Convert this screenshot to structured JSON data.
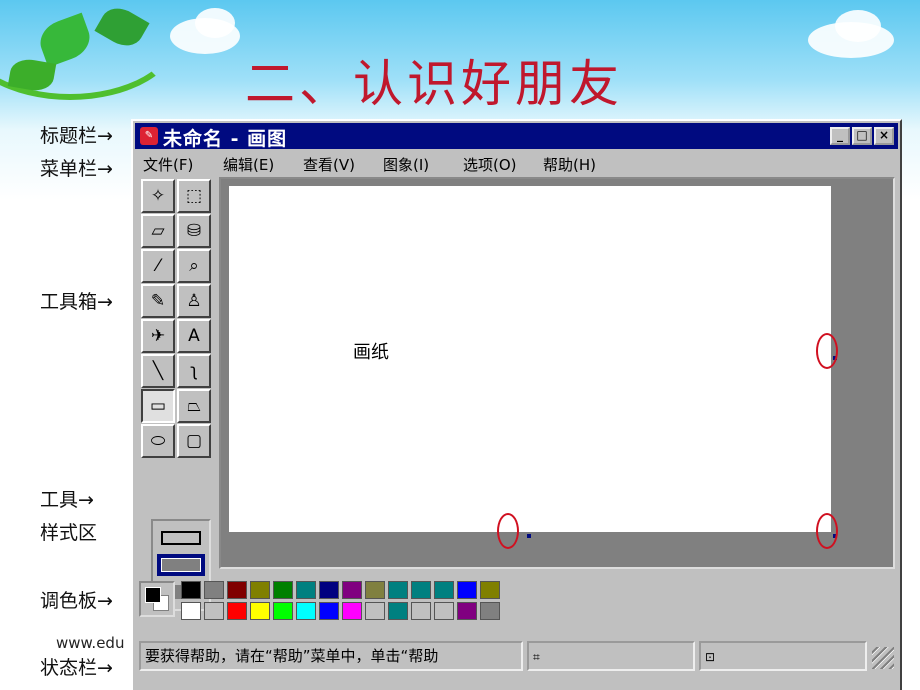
{
  "slide": {
    "title": "二、认识好朋友",
    "url_text": "www.edu"
  },
  "callouts": {
    "titlebar": "标题栏→",
    "menubar": "菜单栏→",
    "toolbox": "工具箱→",
    "tool_style_line1": "工具→",
    "tool_style_line2": "样式区",
    "palette": "调色板→",
    "statusbar": "状态栏→"
  },
  "window": {
    "title": "未命名 - 画图",
    "minimize": "_",
    "maximize": "□",
    "close": "×"
  },
  "menu": [
    "文件(F)",
    "编辑(E)",
    "查看(V)",
    "图象(I)",
    "选项(O)",
    "帮助(H)"
  ],
  "tools": [
    {
      "icon": "free-select-icon",
      "glyph": "✧"
    },
    {
      "icon": "rect-select-icon",
      "glyph": "⬚"
    },
    {
      "icon": "eraser-icon",
      "glyph": "▱"
    },
    {
      "icon": "fill-bucket-icon",
      "glyph": "⛁"
    },
    {
      "icon": "color-picker-icon",
      "glyph": "⁄"
    },
    {
      "icon": "magnifier-icon",
      "glyph": "⌕"
    },
    {
      "icon": "pencil-icon",
      "glyph": "✎"
    },
    {
      "icon": "brush-icon",
      "glyph": "♙"
    },
    {
      "icon": "airbrush-icon",
      "glyph": "✈"
    },
    {
      "icon": "text-icon",
      "glyph": "A"
    },
    {
      "icon": "line-icon",
      "glyph": "╲"
    },
    {
      "icon": "curve-icon",
      "glyph": "ʅ"
    },
    {
      "icon": "rectangle-icon",
      "glyph": "▭"
    },
    {
      "icon": "polygon-icon",
      "glyph": "⏢"
    },
    {
      "icon": "ellipse-icon",
      "glyph": "⬭"
    },
    {
      "icon": "rounded-rect-icon",
      "glyph": "▢"
    }
  ],
  "canvas": {
    "label": "画纸"
  },
  "palette": {
    "foreground": "#000000",
    "background": "#ffffff",
    "row1": [
      "#000000",
      "#808080",
      "#800000",
      "#808000",
      "#008000",
      "#008080",
      "#000080",
      "#800080",
      "#808040",
      "#008080",
      "#008080",
      "#008080",
      "#0000ff",
      "#808000"
    ],
    "row2": [
      "#ffffff",
      "#c0c0c0",
      "#ff0000",
      "#ffff00",
      "#00ff00",
      "#00ffff",
      "#0000ff",
      "#ff00ff",
      "#c0c0c0",
      "#008080",
      "#c0c0c0",
      "#c0c0c0",
      "#800080",
      "#808080"
    ]
  },
  "status": {
    "message": "要获得帮助，请在“帮助”菜单中，单击“帮助"
  }
}
